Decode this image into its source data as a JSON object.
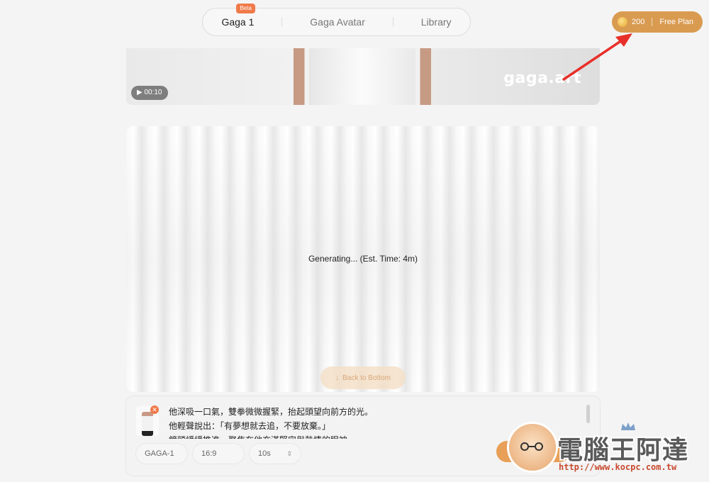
{
  "nav": {
    "tabs": [
      {
        "label": "Gaga 1",
        "active": true,
        "badge": "Beta"
      },
      {
        "label": "Gaga Avatar",
        "active": false
      },
      {
        "label": "Library",
        "active": false
      }
    ]
  },
  "plan": {
    "credits": "200",
    "plan_label": "Free Plan"
  },
  "video": {
    "watermark": "gaga.art",
    "duration": "▶ 00:10"
  },
  "generating": {
    "status": "Generating... (Est. Time: 4m)",
    "back_label": "Back to Bottom"
  },
  "prompt": {
    "lines": [
      "他深吸一口氣，雙拳微微握緊，抬起頭望向前方的光。",
      "他輕聲說出：「有夢想就去追，不要放棄。」",
      "鏡頭緩緩推進，聚焦在他充滿堅定與熱情的眼神。"
    ],
    "model": "GAGA-1",
    "ratio": "16:9",
    "length": "10s"
  },
  "brand": {
    "name": "電腦王阿達",
    "url": "http://www.kocpc.com.tw"
  },
  "colors": {
    "accent": "#d99b50",
    "beta": "#f07a4a",
    "annotation_arrow": "#e8302a"
  }
}
